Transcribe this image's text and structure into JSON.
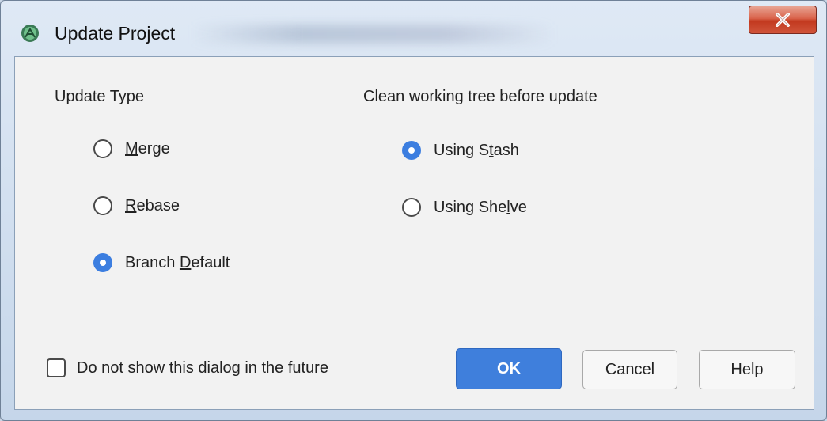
{
  "window": {
    "title": "Update Project",
    "close_label": "x"
  },
  "update_type": {
    "title": "Update Type",
    "options": [
      {
        "label": "Merge",
        "mnemonic_char": "M",
        "checked": false
      },
      {
        "label": "Rebase",
        "mnemonic_char": "R",
        "checked": false
      },
      {
        "label": "Branch Default",
        "mnemonic_char": "D",
        "checked": true
      }
    ]
  },
  "clean_tree": {
    "title": "Clean working tree before update",
    "options": [
      {
        "label": "Using Stash",
        "mnemonic_char": "t",
        "checked": true
      },
      {
        "label": "Using Shelve",
        "mnemonic_char": "l",
        "checked": false
      }
    ]
  },
  "footer": {
    "dont_show_label": "Do not show this dialog in the future",
    "dont_show_checked": false,
    "ok_label": "OK",
    "cancel_label": "Cancel",
    "help_label": "Help"
  },
  "colors": {
    "accent": "#3f7fdc",
    "close_red": "#c2391f",
    "panel_bg": "#f2f2f2"
  }
}
